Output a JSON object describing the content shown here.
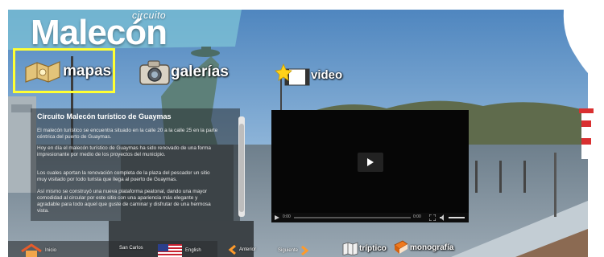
{
  "brand": {
    "small": "circuito",
    "big": "Malecón"
  },
  "nav": {
    "mapas": "mapas",
    "galerias": "galerías",
    "video": "video"
  },
  "panel": {
    "title": "Circuito Malecón turístico  de Guaymas",
    "p1": "El malecón turístico se encuentra situado en la calle 20 a la calle 25 en la parte céntrica del puerto de Guaymas.",
    "p2": "Hoy en día el malecón turístico de Guaymas  ha sido renovado de una forma impresionante por medio de los proyectos del municipio.",
    "p3": "Los cuales aportan  la renovación completa de la plaza del pescador un sitio muy visitado por todo turista que llega al puerto de Guaymas.",
    "p4": "Así mismo se  construyó una nueva plataforma peatonal, dando una mayor comodidad al circular por este sitio con una apariencia más elegante y agradable para todo aquel que  guste de caminar y disfrutar de una hermosa vista."
  },
  "video_player": {
    "time_current": "0:00",
    "time_total": "0:00"
  },
  "bottom": {
    "inicio": "Inicio",
    "san_carlos": "San Carlos",
    "english": "English",
    "anterior": "Anterior",
    "siguiente": "Siguiente",
    "triptico": "tríptico",
    "monografia": "monografía"
  }
}
